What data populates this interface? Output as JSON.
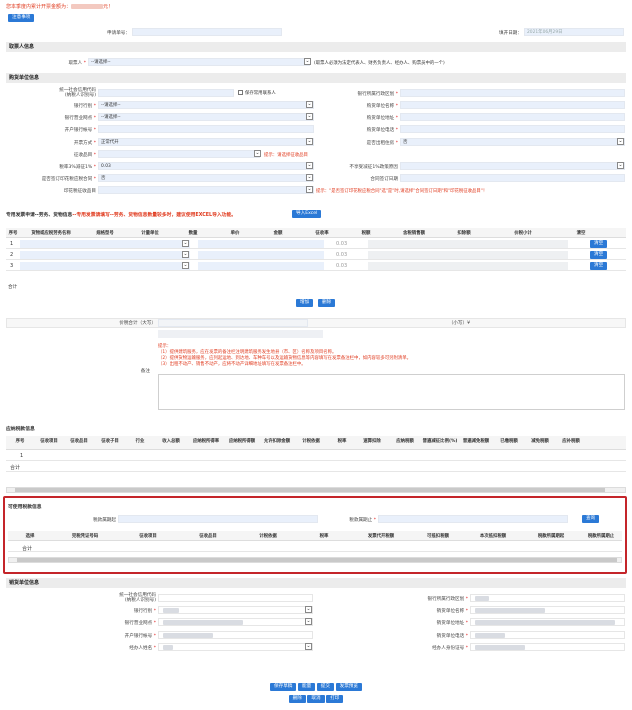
{
  "notice": {
    "text": "您本季度内累计开票金额为：",
    "suffix": "元！"
  },
  "toolbar": {
    "note_btn": "注意事项"
  },
  "header": {
    "apply_no_label": "申请单号：",
    "fill_date_label": "填开日期：",
    "fill_date_value": "2021年06月29日"
  },
  "sec_receiver": {
    "title": "取票人信息",
    "label": "取票人",
    "value": "--请选择--",
    "hint": "(取票人必须为法定代表人、财务负责人、经办人、购票员中的一个)"
  },
  "sec_buyer": {
    "title": "购货单位信息",
    "credit_code_label": "统一社会信用代码\n(纳税人识别号)",
    "save_contact": "保存常用联系人",
    "region_label": "银行所属行政区划",
    "bank_label": "银行行别",
    "bank_value": "--请选择--",
    "name_label": "购货单位名称",
    "branch_label": "银行营业网点",
    "branch_value": "--请选择--",
    "addr_label": "购货单位地址",
    "acct_label": "开户银行帐号",
    "phone_label": "购货单位电话",
    "invoice_type_label": "开票方式",
    "invoice_type_value": "正常代开",
    "tax_free_label": "是否出租住房",
    "tax_free_value": "否",
    "item_label": "征收品目",
    "item_warn": "提示：请选择征收品目",
    "rate_label": "税率3%减征1%",
    "rate_value": "0.03",
    "reduce_label": "不享受减征1%政策原因",
    "contract_label": "是否签订印花税应税合同",
    "contract_value": "否",
    "contract_date_label": "合同签订日期",
    "stamp_label": "印花税征收品目",
    "stamp_warn": "提示：\"是否签订印花税应税合同\"选\"是\"时,请选择\"合同签订日期\"和\"印花税征收品目\"！"
  },
  "sec_goods": {
    "title_prefix": "专用发票申请--劳务、货物信息",
    "title_warn": "--专用发票请填写--劳务、货物信息数量较多时，建议使用EXCEL导入功能。",
    "import_btn": "导入Excel",
    "columns": [
      "序号",
      "货物或应税劳务名称",
      "规格型号",
      "计量单位",
      "数量",
      "单价",
      "金额",
      "征收率",
      "税额",
      "含税销售额",
      "扣除额",
      "价税小计",
      "清空"
    ],
    "rows": [
      {
        "no": "1",
        "rate": "0.03",
        "clear": "清空"
      },
      {
        "no": "2",
        "rate": "0.03",
        "clear": "清空"
      },
      {
        "no": "3",
        "rate": "0.03",
        "clear": "清空"
      }
    ],
    "total_label": "合计",
    "add_btn": "增加",
    "delete_btn": "删除"
  },
  "sec_total": {
    "amount_label": "价税合计（大写）",
    "small_label": "（小写）¥",
    "remark_label": "备注",
    "tip_title": "提示：",
    "tips": [
      "（1）提供建筑服务，应在发票的备注栏注明建筑服务发生地县（市、区）名称及项目名称。",
      "（2）提供货物运输服务，应列起运地、到达地、车种车号以及运输货物信息等内容填写在发票备注栏中，如内容较多可另附清单。",
      "（3）出租不动产、销售不动产，应将不动产详细地址填写在发票备注栏中。"
    ]
  },
  "sec_tax": {
    "title": "应纳税款信息",
    "columns": [
      "序号",
      "征收项目",
      "征收品目",
      "征收子目",
      "行业",
      "收入总额",
      "应纳税所得率",
      "应纳税所得额",
      "允许扣除金额",
      "计税依据",
      "税率",
      "速算扣除",
      "应纳税额",
      "普遍减征比例(%)",
      "普遍减免税额",
      "已缴税额",
      "减免税额",
      "应补税额"
    ],
    "rows": [
      {
        "no": "1"
      }
    ],
    "total_label": "合计"
  },
  "sec_credit": {
    "title": "可使用税款信息",
    "start_label": "税款属期起",
    "end_label": "税款属期止",
    "query_btn": "查询",
    "columns": [
      "选择",
      "完税凭证号码",
      "征收项目",
      "征收品目",
      "计税依据",
      "税率",
      "发票代开税额",
      "可抵扣税额",
      "本次抵扣税额",
      "税款所属期起",
      "税款所属期止"
    ],
    "total_label": "合计"
  },
  "sec_seller": {
    "title": "销货单位信息",
    "credit_code_label": "统一社会信用代码\n(纳税人识别号)",
    "region_label": "银行所属行政区划",
    "bank_label": "银行行别",
    "name_label": "销货单位名称",
    "branch_label": "银行营业网点",
    "addr_label": "销货单位地址",
    "acct_label": "开户银行帐号",
    "phone_label": "销货单位电话",
    "agent_label": "经办人姓名",
    "agent_id_label": "经办人身份证号"
  },
  "footer": {
    "buttons_row1": [
      "保存草稿",
      "能量",
      "提交",
      "发票预览"
    ],
    "buttons_row2": [
      "删除",
      "取消",
      "打印"
    ]
  }
}
